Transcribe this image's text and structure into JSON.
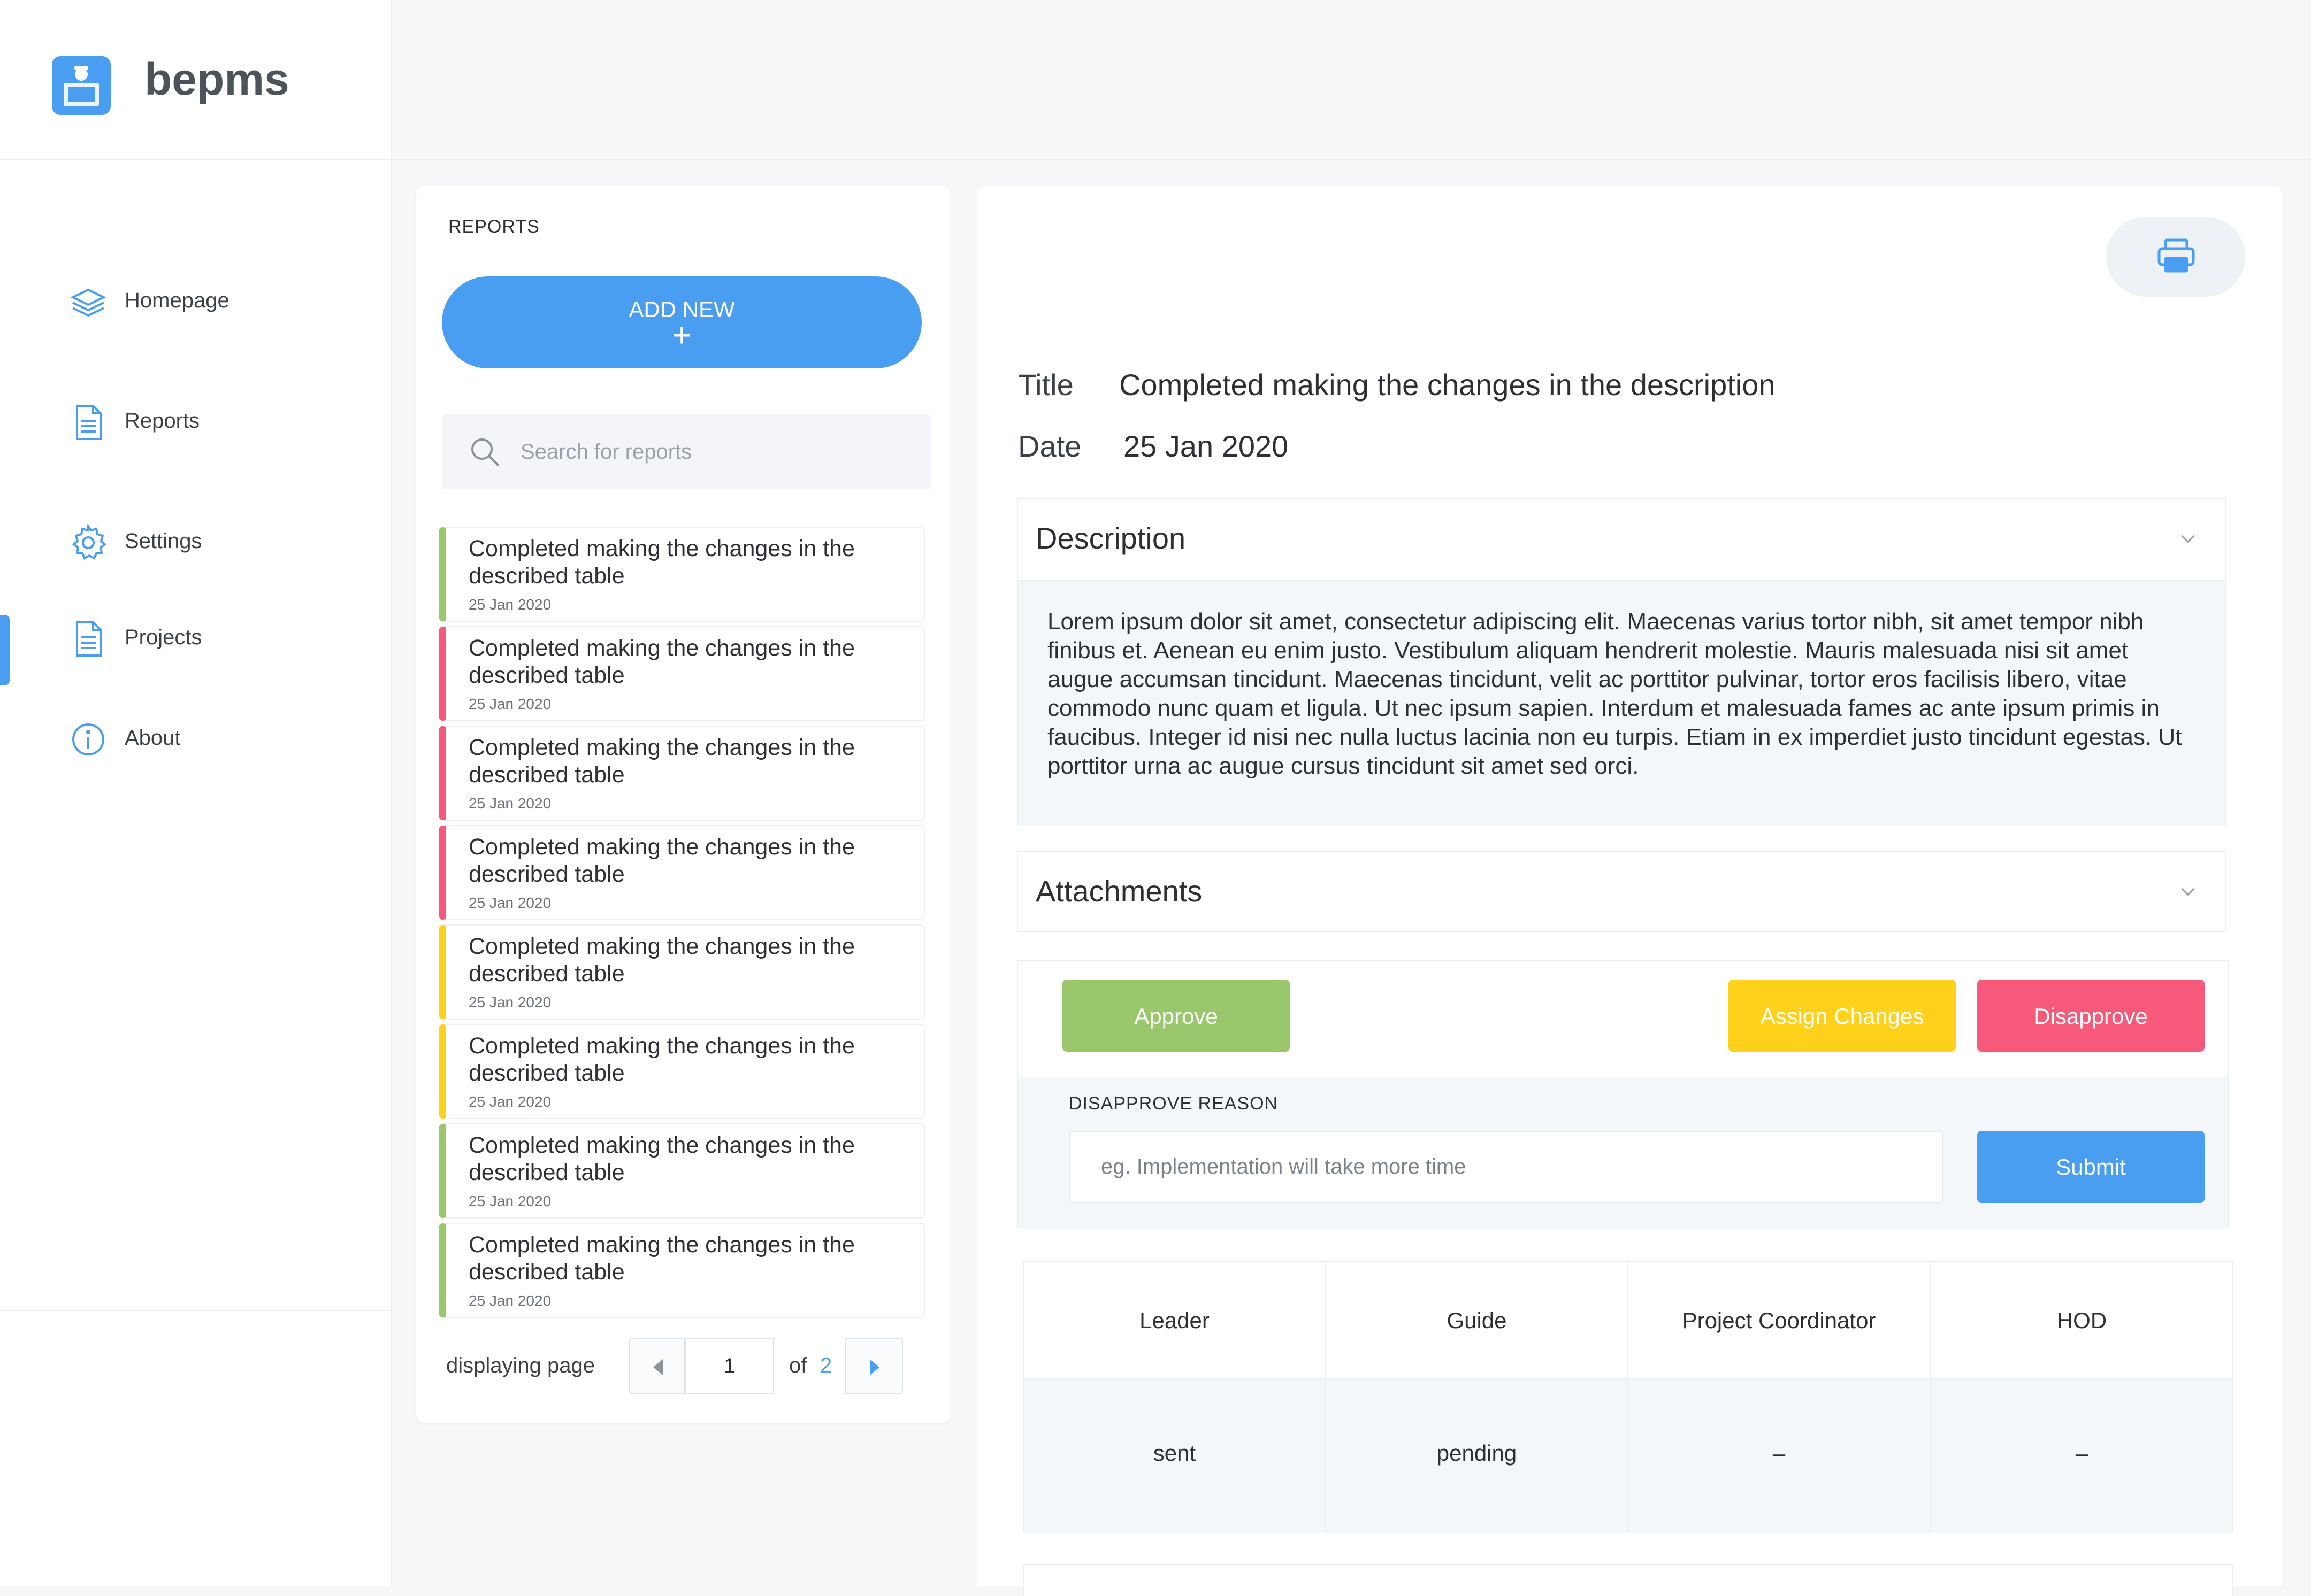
{
  "app": {
    "name": "bepms"
  },
  "colors": {
    "accent": "#4a9ef1",
    "approve": "#9ac66c",
    "assign": "#ffd11a",
    "disapprove": "#f7597b"
  },
  "sidebar": {
    "items": [
      {
        "label": "Homepage",
        "icon": "layers-icon"
      },
      {
        "label": "Reports",
        "icon": "document-icon"
      },
      {
        "label": "Settings",
        "icon": "gear-icon"
      },
      {
        "label": "Projects",
        "icon": "document-icon"
      },
      {
        "label": "About",
        "icon": "info-icon"
      }
    ],
    "active": "Projects"
  },
  "reports": {
    "title": "REPORTS",
    "add_new_label": "ADD NEW",
    "add_new_icon": "+",
    "search_placeholder": "Search for reports",
    "items": [
      {
        "title": "Completed making the changes in the described table",
        "date": "25 Jan 2020",
        "status_color": "#9ac66c"
      },
      {
        "title": "Completed making the changes in the described table",
        "date": "25 Jan 2020",
        "status_color": "#f7597b"
      },
      {
        "title": "Completed making the changes in the described table",
        "date": "25 Jan 2020",
        "status_color": "#f7597b"
      },
      {
        "title": "Completed making the changes in the described table",
        "date": "25 Jan 2020",
        "status_color": "#f7597b"
      },
      {
        "title": "Completed making the changes in the described table",
        "date": "25 Jan 2020",
        "status_color": "#ffd11a"
      },
      {
        "title": "Completed making the changes in the described table",
        "date": "25 Jan 2020",
        "status_color": "#ffd11a"
      },
      {
        "title": "Completed making the changes in the described table",
        "date": "25 Jan 2020",
        "status_color": "#9ac66c"
      },
      {
        "title": "Completed making the changes in the described table",
        "date": "25 Jan 2020",
        "status_color": "#9ac66c"
      }
    ],
    "pager": {
      "label": "displaying page",
      "current": "1",
      "of_label": "of",
      "total": "2"
    }
  },
  "details": {
    "title_label": "Title",
    "title_value": "Completed making the changes in the description",
    "date_label": "Date",
    "date_value": "25 Jan 2020",
    "description": {
      "heading": "Description",
      "text": "Lorem ipsum dolor sit amet, consectetur adipiscing elit. Maecenas varius tortor nibh, sit amet tempor nibh finibus et. Aenean eu enim justo. Vestibulum aliquam hendrerit molestie. Mauris malesuada nisi sit amet augue accumsan tincidunt. Maecenas tincidunt, velit ac porttitor pulvinar, tortor eros facilisis libero, vitae commodo nunc quam et ligula. Ut nec ipsum sapien. Interdum et malesuada fames ac ante ipsum primis in faucibus. Integer id nisi nec nulla luctus lacinia non eu turpis. Etiam in ex imperdiet justo tincidunt egestas. Ut porttitor urna ac augue cursus tincidunt sit amet sed orci."
    },
    "attachments": {
      "heading": "Attachments"
    },
    "actions": {
      "approve_label": "Approve",
      "assign_label": "Assign Changes",
      "disapprove_label": "Disapprove",
      "reason_label": "DISAPPROVE REASON",
      "reason_placeholder": "eg. Implementation will take more time",
      "submit_label": "Submit"
    },
    "status_table": {
      "headers": [
        "Leader",
        "Guide",
        "Project Coordinator",
        "HOD"
      ],
      "values": [
        "sent",
        "pending",
        "–",
        "–"
      ]
    }
  }
}
